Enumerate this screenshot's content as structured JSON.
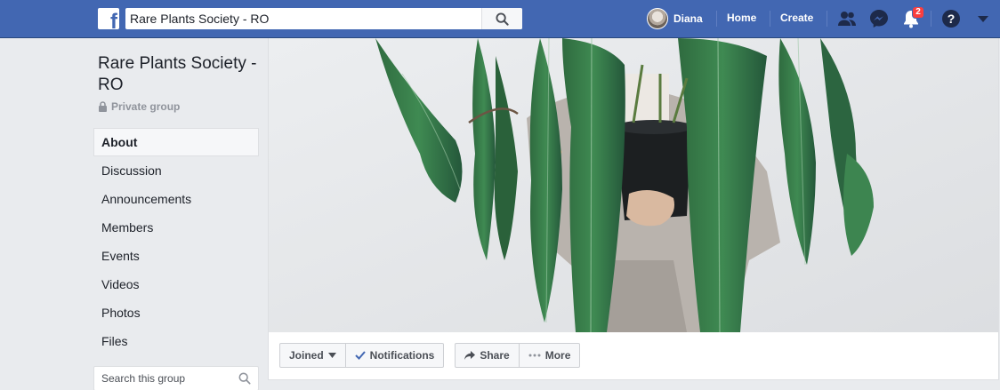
{
  "topbar": {
    "logo": "f",
    "search_value": "Rare Plants Society - RO",
    "user_name": "Diana",
    "home_label": "Home",
    "create_label": "Create",
    "notifications_count": "2",
    "icons": [
      "friends-icon",
      "messenger-icon",
      "notifications-icon",
      "help-icon",
      "account-menu-icon"
    ]
  },
  "group": {
    "title": "Rare Plants Society - RO",
    "privacy": "Private group"
  },
  "sidebar": {
    "items": [
      {
        "label": "About"
      },
      {
        "label": "Discussion"
      },
      {
        "label": "Announcements"
      },
      {
        "label": "Members"
      },
      {
        "label": "Events"
      },
      {
        "label": "Videos"
      },
      {
        "label": "Photos"
      },
      {
        "label": "Files"
      }
    ],
    "search_placeholder": "Search this group"
  },
  "actions": {
    "joined": "Joined",
    "notifications": "Notifications",
    "share": "Share",
    "more": "More"
  },
  "colors": {
    "brand": "#4267b2",
    "badge": "#fa3e3e",
    "background": "#e9ebee"
  }
}
